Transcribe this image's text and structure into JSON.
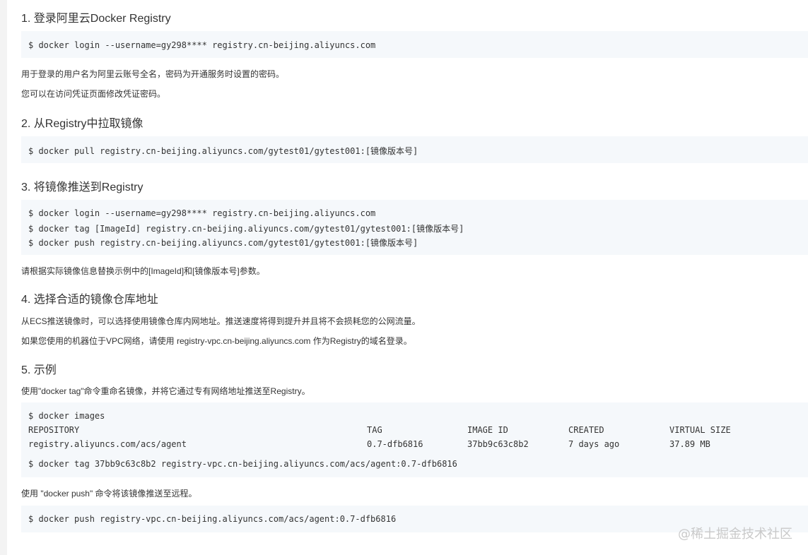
{
  "sections": [
    {
      "title": "1. 登录阿里云Docker Registry"
    },
    {
      "title": "2. 从Registry中拉取镜像"
    },
    {
      "title": "3. 将镜像推送到Registry"
    },
    {
      "title": "4. 选择合适的镜像仓库地址"
    },
    {
      "title": "5. 示例"
    }
  ],
  "s1": {
    "code": "$ docker login --username=gy298**** registry.cn-beijing.aliyuncs.com",
    "p1": "用于登录的用户名为阿里云账号全名，密码为开通服务时设置的密码。",
    "p2": "您可以在访问凭证页面修改凭证密码。"
  },
  "s2": {
    "code": "$ docker pull registry.cn-beijing.aliyuncs.com/gytest01/gytest001:[镜像版本号]"
  },
  "s3": {
    "code": [
      "$ docker login --username=gy298**** registry.cn-beijing.aliyuncs.com",
      "$ docker tag [ImageId] registry.cn-beijing.aliyuncs.com/gytest01/gytest001:[镜像版本号]",
      "$ docker push registry.cn-beijing.aliyuncs.com/gytest01/gytest001:[镜像版本号]"
    ],
    "p1": "请根据实际镜像信息替换示例中的[ImageId]和[镜像版本号]参数。"
  },
  "s4": {
    "p1": "从ECS推送镜像时，可以选择使用镜像仓库内网地址。推送速度将得到提升并且将不会损耗您的公网流量。",
    "p2": "如果您使用的机器位于VPC网络，请使用 registry-vpc.cn-beijing.aliyuncs.com 作为Registry的域名登录。"
  },
  "s5": {
    "p1": "使用\"docker tag\"命令重命名镜像，并将它通过专有网络地址推送至Registry。",
    "cmd1": "$ docker images",
    "table": {
      "headers": [
        "REPOSITORY",
        "TAG",
        "IMAGE ID",
        "CREATED",
        "VIRTUAL SIZE"
      ],
      "row": [
        "registry.aliyuncs.com/acs/agent",
        "0.7-dfb6816",
        "37bb9c63c8b2",
        "7 days ago",
        "37.89 MB"
      ]
    },
    "cmd2": "$ docker tag 37bb9c63c8b2 registry-vpc.cn-beijing.aliyuncs.com/acs/agent:0.7-dfb6816",
    "p2": "使用 \"docker push\" 命令将该镜像推送至远程。",
    "cmd3": "$ docker push registry-vpc.cn-beijing.aliyuncs.com/acs/agent:0.7-dfb6816"
  },
  "watermark": "@稀土掘金技术社区"
}
